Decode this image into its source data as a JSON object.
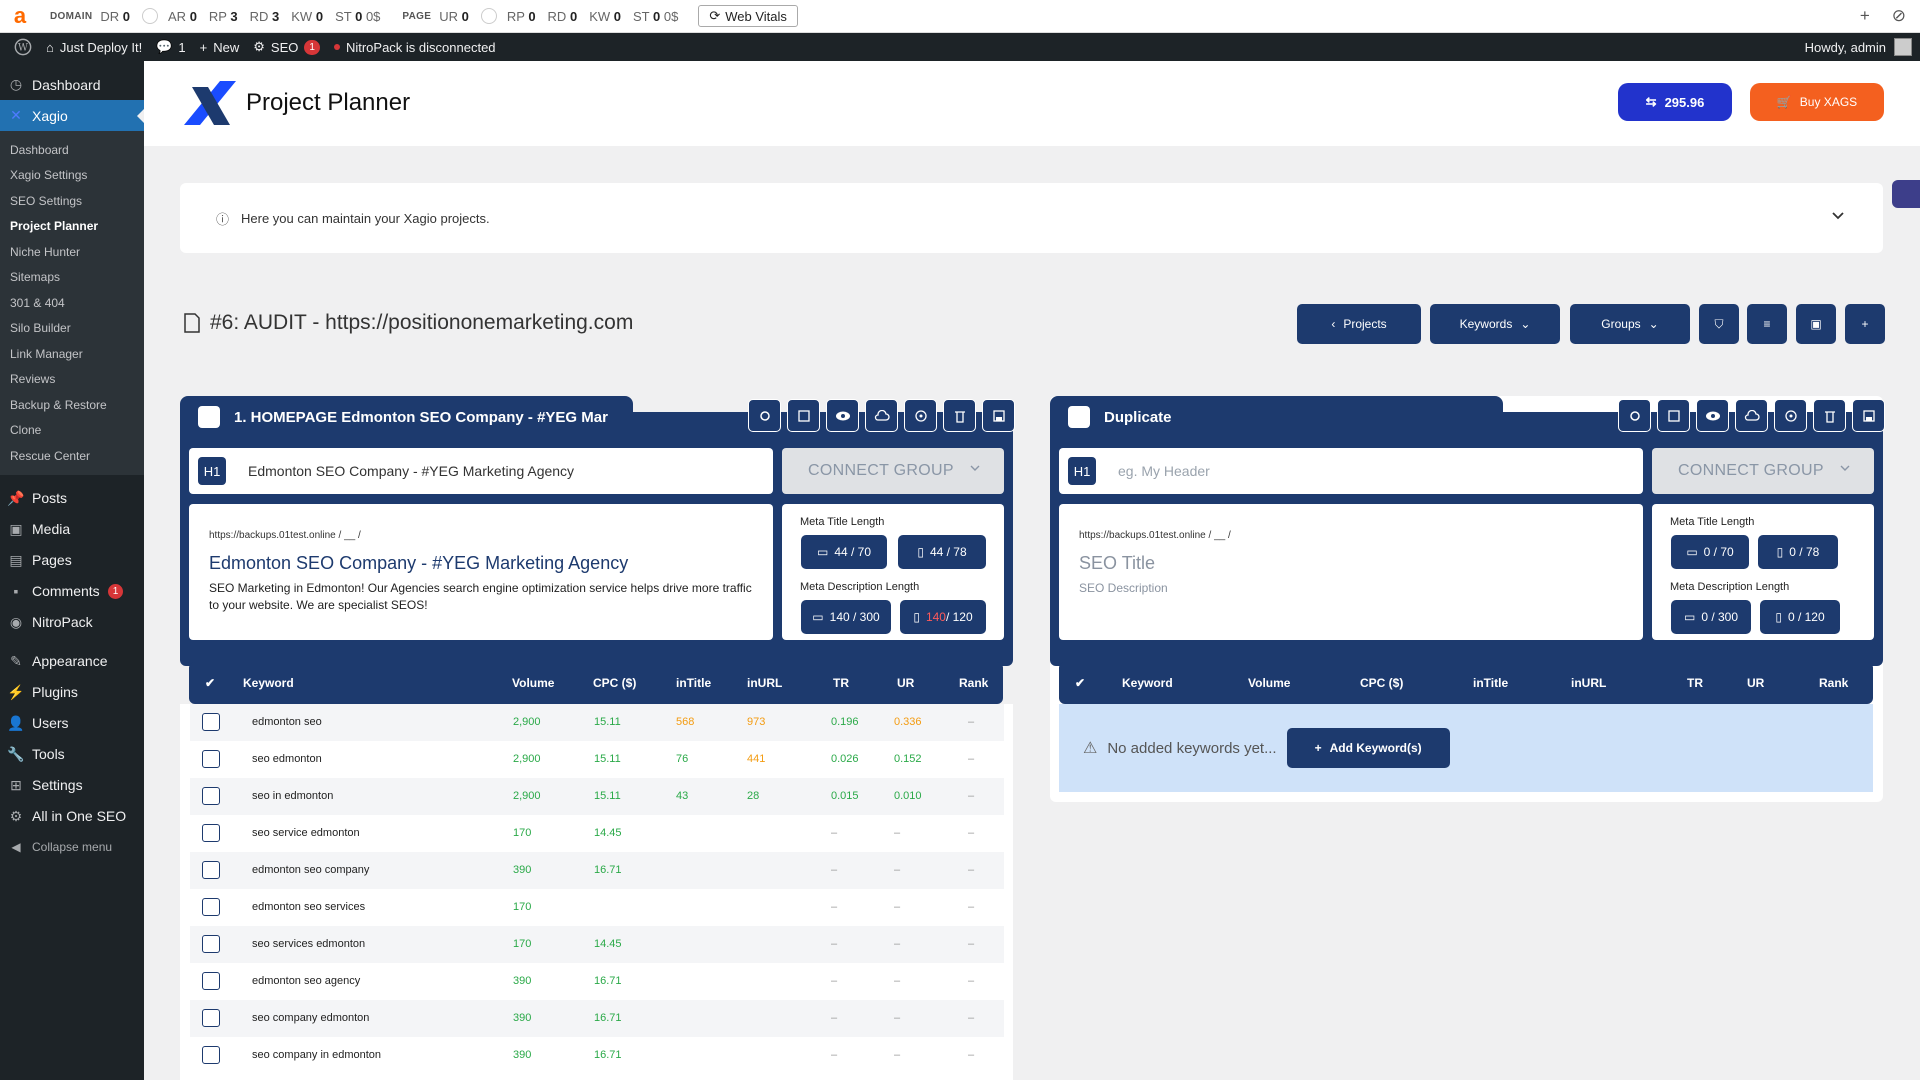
{
  "ahrefs_bar": {
    "domain_label": "DOMAIN",
    "dr_label": "DR",
    "dr": "0",
    "ar_label": "AR",
    "ar": "0",
    "rp_label": "RP",
    "rp": "3",
    "rd_label": "RD",
    "rd": "3",
    "kw_label": "KW",
    "kw": "0",
    "st_label": "ST",
    "st": "0",
    "st_unit": "0$",
    "page_label": "PAGE",
    "ur_label": "UR",
    "ur": "0",
    "prp": "0",
    "prd": "0",
    "pkw": "0",
    "pst": "0",
    "pst_unit": "0$",
    "web_vitals": "Web Vitals"
  },
  "wp_bar": {
    "site": "Just Deploy It!",
    "comments": "1",
    "new": "New",
    "seo": "SEO",
    "seo_badge": "1",
    "nitro": "NitroPack is disconnected",
    "howdy": "Howdy, admin"
  },
  "sidebar": {
    "dashboard": "Dashboard",
    "xagio": "Xagio",
    "sub": [
      "Dashboard",
      "Xagio Settings",
      "SEO Settings",
      "Project Planner",
      "Niche Hunter",
      "Sitemaps",
      "301 & 404",
      "Silo Builder",
      "Link Manager",
      "Reviews",
      "Backup & Restore",
      "Clone",
      "Rescue Center"
    ],
    "menu": [
      "Posts",
      "Media",
      "Pages",
      "Comments",
      "NitroPack"
    ],
    "comments_badge": "1",
    "menu2": [
      "Appearance",
      "Plugins",
      "Users",
      "Tools",
      "Settings",
      "All in One SEO",
      "Collapse menu"
    ]
  },
  "header": {
    "title": "Project Planner",
    "credits": "295.96",
    "buy": "Buy XAGS"
  },
  "info": {
    "text": "Here you can maintain your Xagio projects."
  },
  "project": {
    "title": "#6: AUDIT - https://positiononemarketing.com",
    "projects_btn": "Projects",
    "keywords_btn": "Keywords",
    "groups_btn": "Groups"
  },
  "group1": {
    "name": "1. HOMEPAGE Edmonton SEO Company - #YEG Mar",
    "h1_label": "H1",
    "h1": "Edmonton SEO Company - #YEG Marketing Agency",
    "connect": "CONNECT GROUP",
    "url": "https://backups.01test.online / __ /",
    "seo_title": "Edmonton SEO Company - #YEG Marketing Agency",
    "seo_desc": "SEO Marketing in Edmonton! Our Agencies search engine optimization service helps drive more traffic to your website. We are specialist SEOS!",
    "mt_label": "Meta Title Length",
    "mt_desktop": "44 / 70",
    "mt_mobile": "44 / 78",
    "md_label": "Meta Description Length",
    "md_desktop": "140 / 300",
    "md_mobile_a": "140",
    "md_mobile_b": " / 120"
  },
  "group2": {
    "name": "Duplicate",
    "h1_label": "H1",
    "h1_placeholder": "eg. My Header",
    "connect": "CONNECT GROUP",
    "url": "https://backups.01test.online / __ /",
    "seo_title": "SEO Title",
    "seo_desc": "SEO Description",
    "mt_label": "Meta Title Length",
    "mt_desktop": "0 / 70",
    "mt_mobile": "0 / 78",
    "md_label": "Meta Description Length",
    "md_desktop": "0 / 300",
    "md_mobile": "0 / 120",
    "empty": "No added keywords yet...",
    "add_kw": "Add Keyword(s)"
  },
  "table_headers": {
    "keyword": "Keyword",
    "volume": "Volume",
    "cpc": "CPC ($)",
    "intitle": "inTitle",
    "inurl": "inURL",
    "tr": "TR",
    "ur": "UR",
    "rank": "Rank"
  },
  "keywords": [
    {
      "kw": "edmonton seo",
      "vol": "2,900",
      "cpc": "15.11",
      "intitle": "568",
      "inurl": "973",
      "tr": "0.196",
      "ur": "0.336",
      "rank": "–"
    },
    {
      "kw": "seo edmonton",
      "vol": "2,900",
      "cpc": "15.11",
      "intitle": "76",
      "inurl": "441",
      "tr": "0.026",
      "ur": "0.152",
      "rank": "–"
    },
    {
      "kw": "seo in edmonton",
      "vol": "2,900",
      "cpc": "15.11",
      "intitle": "43",
      "inurl": "28",
      "tr": "0.015",
      "ur": "0.010",
      "rank": "–"
    },
    {
      "kw": "seo service edmonton",
      "vol": "170",
      "cpc": "14.45",
      "intitle": "",
      "inurl": "",
      "tr": "–",
      "ur": "–",
      "rank": "–"
    },
    {
      "kw": "edmonton seo company",
      "vol": "390",
      "cpc": "16.71",
      "intitle": "",
      "inurl": "",
      "tr": "–",
      "ur": "–",
      "rank": "–"
    },
    {
      "kw": "edmonton seo services",
      "vol": "170",
      "cpc": "",
      "intitle": "",
      "inurl": "",
      "tr": "–",
      "ur": "–",
      "rank": "–"
    },
    {
      "kw": "seo services edmonton",
      "vol": "170",
      "cpc": "14.45",
      "intitle": "",
      "inurl": "",
      "tr": "–",
      "ur": "–",
      "rank": "–"
    },
    {
      "kw": "edmonton seo agency",
      "vol": "390",
      "cpc": "16.71",
      "intitle": "",
      "inurl": "",
      "tr": "–",
      "ur": "–",
      "rank": "–"
    },
    {
      "kw": "seo company edmonton",
      "vol": "390",
      "cpc": "16.71",
      "intitle": "",
      "inurl": "",
      "tr": "–",
      "ur": "–",
      "rank": "–"
    },
    {
      "kw": "seo company in edmonton",
      "vol": "390",
      "cpc": "16.71",
      "intitle": "",
      "inurl": "",
      "tr": "–",
      "ur": "–",
      "rank": "–"
    }
  ]
}
